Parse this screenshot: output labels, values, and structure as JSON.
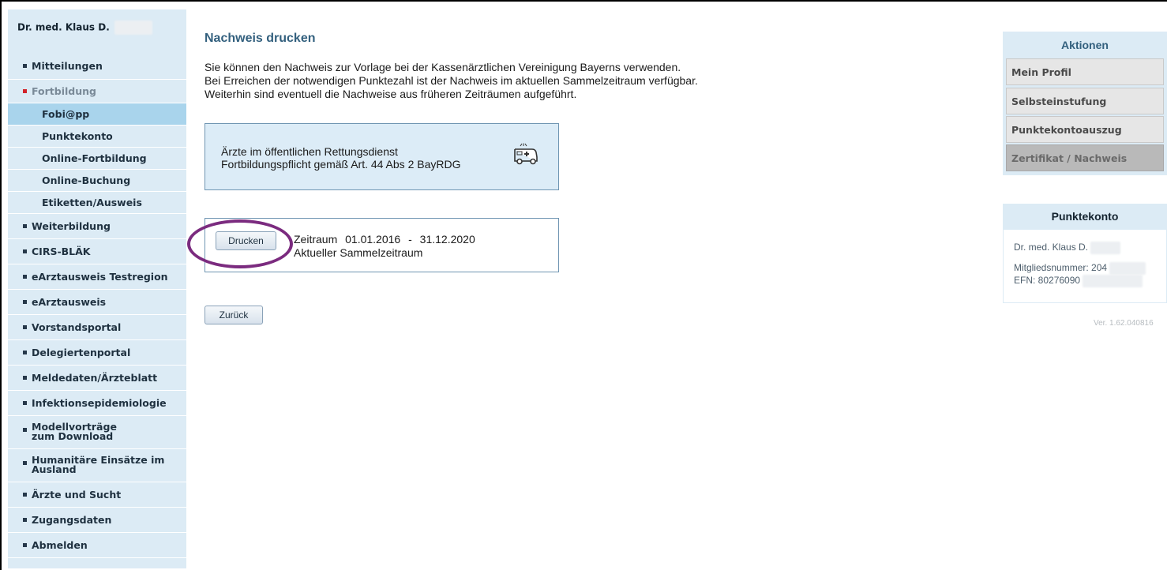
{
  "sidebar": {
    "user_name": "Dr. med. Klaus D.",
    "items": [
      {
        "label": "Mitteilungen"
      },
      {
        "label": "Fortbildung"
      },
      {
        "label": "Fobi@pp"
      },
      {
        "label": "Punktekonto"
      },
      {
        "label": "Online-Fortbildung"
      },
      {
        "label": "Online-Buchung"
      },
      {
        "label": "Etiketten/Ausweis"
      },
      {
        "label": "Weiterbildung"
      },
      {
        "label": "CIRS-BLÄK"
      },
      {
        "label": "eArztausweis Testregion"
      },
      {
        "label": "eArztausweis"
      },
      {
        "label": "Vorstandsportal"
      },
      {
        "label": "Delegiertenportal"
      },
      {
        "label": "Meldedaten/Ärzteblatt"
      },
      {
        "label": "Infektionsepidemiologie"
      },
      {
        "label": "Modellvorträge",
        "label2": "zum Download"
      },
      {
        "label": "Humanitäre Einsätze im",
        "label2": "Ausland"
      },
      {
        "label": "Ärzte und Sucht"
      },
      {
        "label": "Zugangsdaten"
      },
      {
        "label": "Abmelden"
      }
    ]
  },
  "main": {
    "title": "Nachweis drucken",
    "intro": [
      "Sie können den Nachweis zur Vorlage bei der Kassenärztlichen Vereinigung Bayerns verwenden.",
      "Bei Erreichen der notwendigen Punktezahl ist der Nachweis im aktuellen Sammelzeitraum verfügbar.",
      "Weiterhin sind eventuell die Nachweise aus früheren Zeiträumen aufgeführt."
    ],
    "info_box": {
      "line1": "Ärzte im öffentlichen Rettungsdienst",
      "line2": "Fortbildungspflicht gemäß Art. 44 Abs 2 BayRDG",
      "icon": "ambulance-icon"
    },
    "period": {
      "button_label": "Drucken",
      "label": "Zeitraum",
      "start": "01.01.2016",
      "separator": "-",
      "end": "31.12.2020",
      "subtitle": "Aktueller Sammelzeitraum"
    },
    "back_label": "Zurück"
  },
  "actions": {
    "title": "Aktionen",
    "items": [
      {
        "label": "Mein Profil"
      },
      {
        "label": "Selbsteinstufung"
      },
      {
        "label": "Punktekontoauszug"
      },
      {
        "label": "Zertifikat / Nachweis"
      }
    ]
  },
  "konto": {
    "title": "Punktekonto",
    "name": "Dr. med. Klaus D.",
    "member_label": "Mitgliedsnummer: 204",
    "efn_label": "EFN: 80276090"
  },
  "version": "Ver. 1.62.040816",
  "colors": {
    "sidebar_bg": "#dcebf5",
    "active_item_bg": "#a9d4ec",
    "title_blue": "#33607e",
    "highlight_ring": "#7b2b7f",
    "red_bullet": "#d2232a"
  }
}
